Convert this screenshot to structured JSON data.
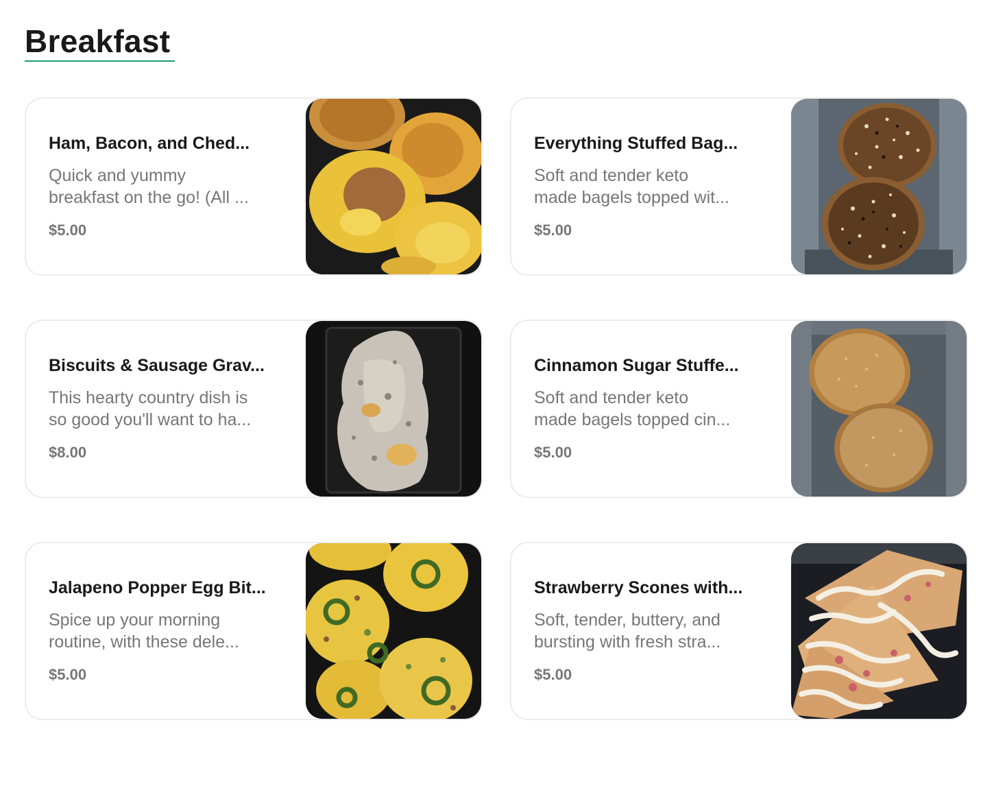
{
  "section": {
    "title": "Breakfast"
  },
  "items": [
    {
      "name": "Ham, Bacon, and Ched...",
      "desc_line1": "Quick and yummy",
      "desc_line2": "breakfast on the go! (All ...",
      "price": "$5.00",
      "image_icon": "egg-muffins-photo"
    },
    {
      "name": "Everything Stuffed Bag...",
      "desc_line1": "Soft and tender keto",
      "desc_line2": "made bagels topped wit...",
      "price": "$5.00",
      "image_icon": "everything-bagels-photo"
    },
    {
      "name": "Biscuits & Sausage Grav...",
      "desc_line1": "This hearty country dish is",
      "desc_line2": "so good you'll want to ha...",
      "price": "$8.00",
      "image_icon": "biscuits-gravy-photo"
    },
    {
      "name": "Cinnamon Sugar Stuffe...",
      "desc_line1": "Soft and tender keto",
      "desc_line2": "made bagels topped cin...",
      "price": "$5.00",
      "image_icon": "cinnamon-bagels-photo"
    },
    {
      "name": "Jalapeno Popper Egg Bit...",
      "desc_line1": "Spice up your morning",
      "desc_line2": "routine, with these dele...",
      "price": "$5.00",
      "image_icon": "jalapeno-egg-bites-photo"
    },
    {
      "name": "Strawberry Scones with...",
      "desc_line1": "Soft, tender, buttery, and",
      "desc_line2": "bursting with fresh stra...",
      "price": "$5.00",
      "image_icon": "strawberry-scones-photo"
    }
  ],
  "colors": {
    "accent_underline": "#1f9b6f",
    "text_primary": "#191919",
    "text_secondary": "#767676",
    "card_border": "#ececec"
  }
}
